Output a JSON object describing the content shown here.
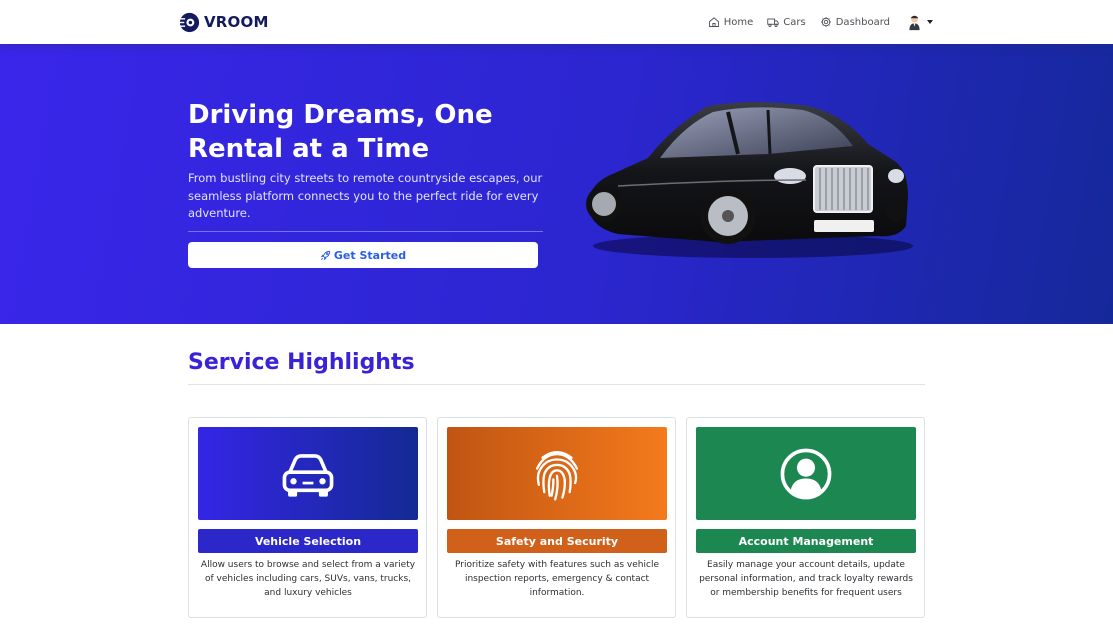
{
  "brand": {
    "name": "VROOM"
  },
  "nav": {
    "items": [
      {
        "label": "Home",
        "icon": "home-icon"
      },
      {
        "label": "Cars",
        "icon": "truck-icon"
      },
      {
        "label": "Dashboard",
        "icon": "gear-icon"
      }
    ],
    "avatar_icon": "user-avatar-icon"
  },
  "hero": {
    "title": "Driving Dreams, One Rental at a Time",
    "subtitle": "From bustling city streets to remote countryside escapes, our seamless platform connects you to the perfect ride for every adventure.",
    "cta_label": "Get Started",
    "cta_icon": "rocket-icon",
    "image": "black-luxury-car"
  },
  "highlights": {
    "title": "Service Highlights",
    "cards": [
      {
        "title": "Vehicle Selection",
        "icon": "car-icon",
        "description": "Allow users to browse and select from a variety of vehicles including cars, SUVs, vans, trucks, and luxury vehicles",
        "color_from": "#3525e6",
        "color_to": "#132a93",
        "label_color": "#2c27c8"
      },
      {
        "title": "Safety and Security",
        "icon": "fingerprint-icon",
        "description": "Prioritize safety with features such as vehicle inspection reports, emergency & contact information.",
        "color_from": "#c05512",
        "color_to": "#f47a1c",
        "label_color": "#d0601a"
      },
      {
        "title": "Account Management",
        "icon": "user-circle-icon",
        "description": "Easily manage your account details, update personal information, and track loyalty rewards or membership benefits for frequent users",
        "color_from": "#1d8752",
        "color_to": "#1d8752",
        "label_color": "#1d8752"
      }
    ]
  },
  "colors": {
    "accent": "#3a22d8",
    "cta_text": "#2a5ee8",
    "brand_text": "#131a5e"
  }
}
